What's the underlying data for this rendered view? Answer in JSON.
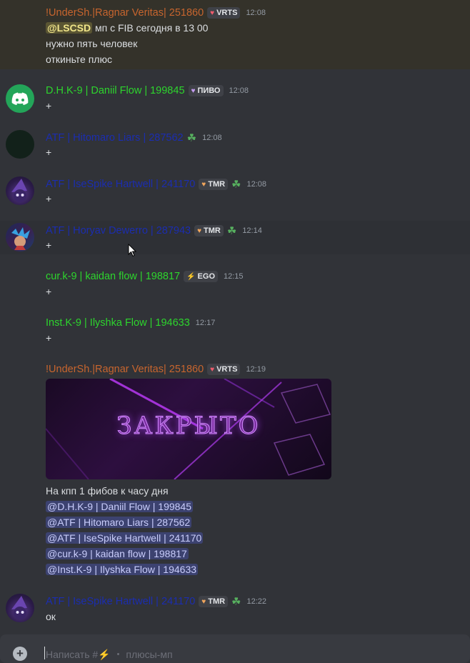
{
  "colors": {
    "background": "#313338",
    "green_name": "#2dd52d",
    "orange_name": "#c7652e",
    "navy_name": "#1b2db0"
  },
  "messages": [
    {
      "name": "!UnderSh.|Ragnar Veritas| 251860",
      "tag": "VRTS",
      "time": "12:08",
      "mention": "@LSCSD",
      "line1": " мп с FIB сегодня в 13 00",
      "line2": "нужно пять человек",
      "line3": "откиньте плюс"
    },
    {
      "name": "D.H.K-9 | Daniil Flow | 199845",
      "tag": "ПИВО",
      "time": "12:08",
      "text": "+"
    },
    {
      "name": "ATF | Hitomaro Liars | 287562",
      "time": "12:08",
      "text": "+"
    },
    {
      "name": "ATF | IseSpike Hartwell | 241170",
      "tag": "TMR",
      "time": "12:08",
      "text": "+"
    },
    {
      "name": "ATF | Horyav Dewerro | 287943",
      "tag": "TMR",
      "time": "12:14",
      "text": "+"
    },
    {
      "name": "cur.k-9 | kaidan flow | 198817",
      "tag": "EGO",
      "time": "12:15",
      "text": "+"
    },
    {
      "name": "Inst.K-9 | Ilyshka Flow | 194633",
      "time": "12:17",
      "text": "+"
    },
    {
      "name": "!UnderSh.|Ragnar Veritas| 251860",
      "tag": "VRTS",
      "time": "12:19",
      "image_text": "ЗАКРЫТО",
      "text": "На кпп 1 фибов к  часу дня",
      "mentions": [
        "@D.H.K-9 | Daniil Flow | 199845",
        "@ATF | Hitomaro Liars | 287562",
        "@ATF | IseSpike Hartwell | 241170",
        "@cur.k-9 | kaidan flow | 198817",
        "@Inst.K-9 | Ilyshka Flow | 194633"
      ]
    },
    {
      "name": "ATF | IseSpike Hartwell | 241170",
      "tag": "TMR",
      "time": "12:22",
      "text": "ок"
    }
  ],
  "composer": {
    "placeholder": "Написать #⚡ ・ плюсы-мп"
  }
}
